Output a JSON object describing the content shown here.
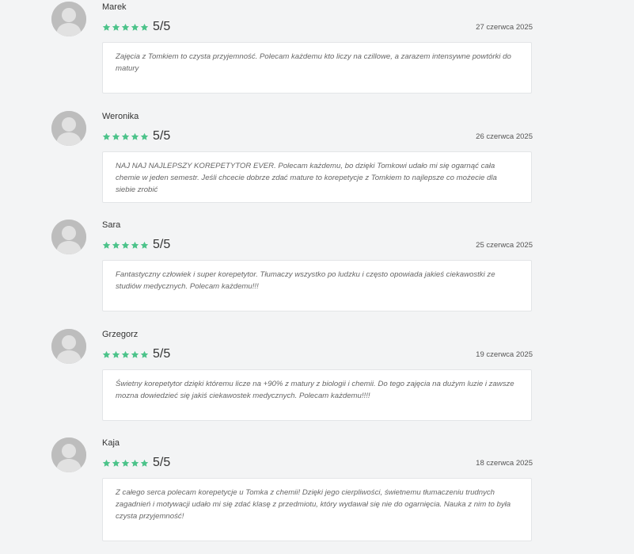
{
  "theme": {
    "star_color": "#4cc38a",
    "avatar_color": "#bdbdbd",
    "background": "#f3f4f5"
  },
  "reviews": [
    {
      "name": "Marek",
      "rating_value": 5,
      "rating_text": "5/5",
      "date": "27 czerwca 2025",
      "comment": "Zajęcia z Tomkiem to czysta przyjemność. Polecam każdemu kto liczy na czillowe, a zarazem intensywne powtórki do matury"
    },
    {
      "name": "Weronika",
      "rating_value": 5,
      "rating_text": "5/5",
      "date": "26 czerwca 2025",
      "comment": "NAJ NAJ NAJLEPSZY KOREPETYTOR EVER. Polecam każdemu, bo dzięki Tomkowi udało mi się ogarnąć cała chemie w jeden semestr. Jeśli chcecie dobrze zdać mature to korepetycje z Tomkiem to najlepsze co możecie dla siebie zrobić"
    },
    {
      "name": "Sara",
      "rating_value": 5,
      "rating_text": "5/5",
      "date": "25 czerwca 2025",
      "comment": "Fantastyczny człowiek i super korepetytor. Tłumaczy wszystko po ludzku i często opowiada jakieś ciekawostki ze studiów medycznych. Polecam każdemu!!!"
    },
    {
      "name": "Grzegorz",
      "rating_value": 5,
      "rating_text": "5/5",
      "date": "19 czerwca 2025",
      "comment": "Świetny korepetytor dzięki któremu licze na +90% z matury z biologii i chemii. Do tego zajęcia na dużym luzie i zawsze mozna dowiedzieć się jakiś ciekawostek medycznych. Polecam każdemu!!!!"
    },
    {
      "name": "Kaja",
      "rating_value": 5,
      "rating_text": "5/5",
      "date": "18 czerwca 2025",
      "comment": "Z całego serca polecam korepetycje u Tomka z chemii! Dzięki jego cierpliwości, świetnemu tłumaczeniu trudnych zagadnień i motywacji udało mi się zdać klasę z przedmiotu, który wydawał się nie do ogarnięcia. Nauka z nim to była czysta przyjemność!"
    }
  ]
}
